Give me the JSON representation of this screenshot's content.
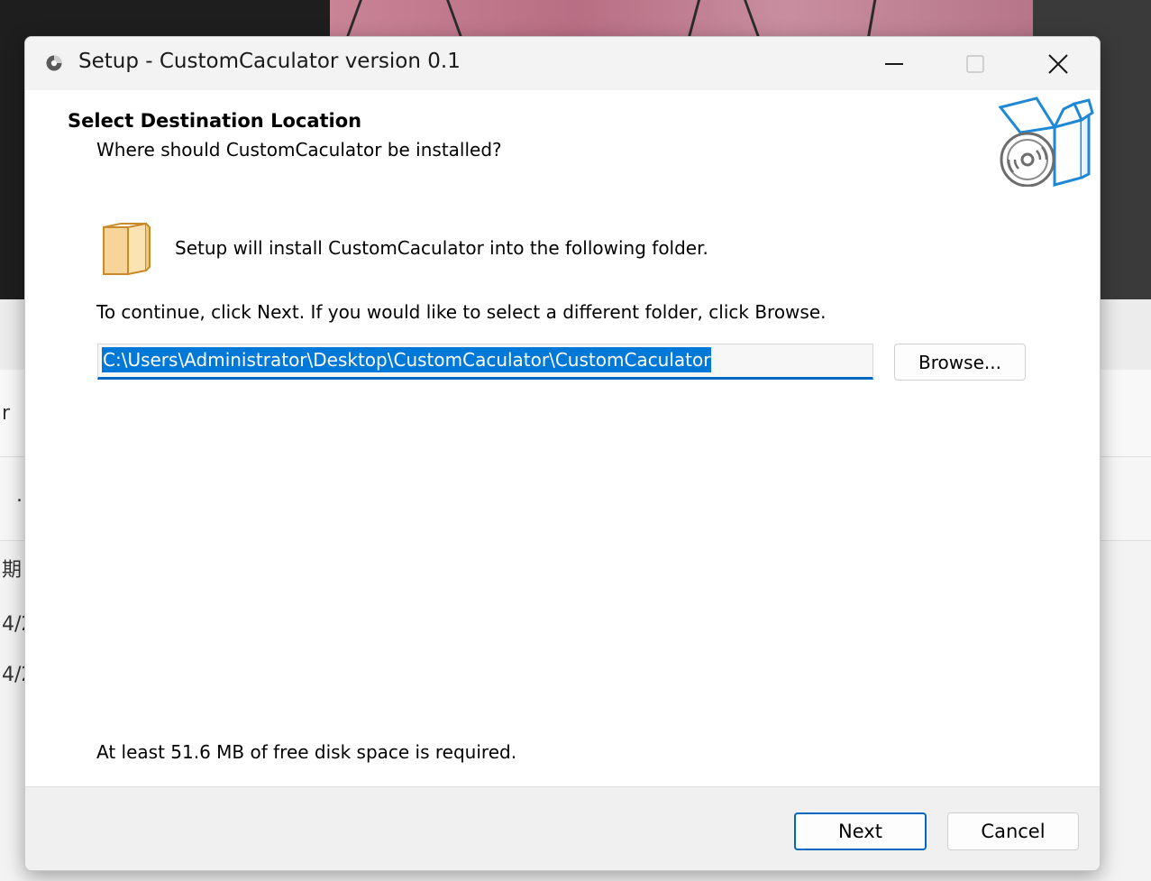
{
  "background": {
    "fragments": [
      "r",
      ".",
      "期",
      "4/2",
      "4/2"
    ]
  },
  "window": {
    "title": "Setup - CustomCaculator version 0.1",
    "controls": {
      "minimize": "minimize-icon",
      "maximize": "maximize-icon",
      "close": "close-icon"
    }
  },
  "header": {
    "heading": "Select Destination Location",
    "subheading": "Where should CustomCaculator be installed?",
    "icon": "install-box-disc-icon"
  },
  "content": {
    "install_text": "Setup will install CustomCaculator into the following folder.",
    "continue_text": "To continue, click Next. If you would like to select a different folder, click Browse.",
    "path_value": "C:\\Users\\Administrator\\Desktop\\CustomCaculator\\CustomCaculator",
    "browse_label": "Browse...",
    "disk_space_text": "At least 51.6 MB of free disk space is required."
  },
  "footer": {
    "next_label": "Next",
    "cancel_label": "Cancel"
  },
  "colors": {
    "accent": "#0067c0",
    "selection": "#0078d7",
    "titlebar": "#f3f3f3",
    "footer": "#f0f0f0"
  }
}
